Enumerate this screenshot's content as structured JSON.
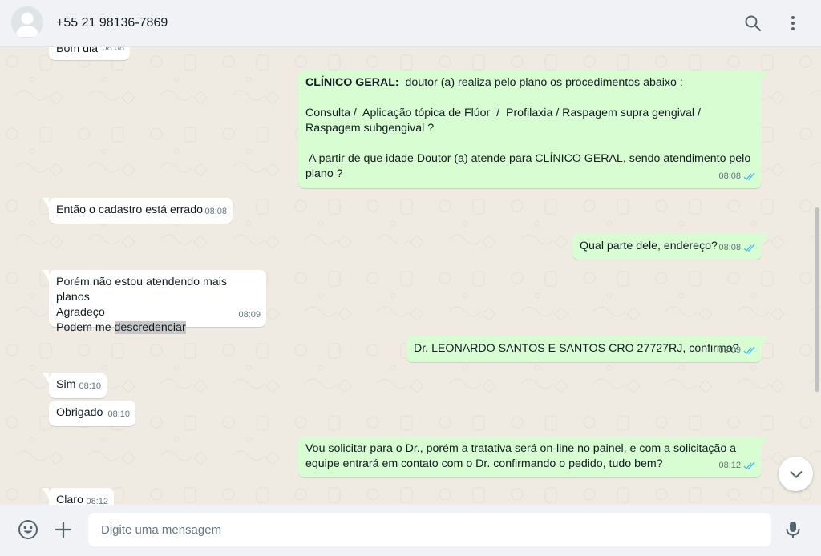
{
  "header": {
    "contact_name": "+55 21 98136-7869",
    "icons": [
      "avatar-placeholder",
      "search-icon",
      "menu-kebab-icon"
    ]
  },
  "messages": [
    {
      "dir": "in",
      "text": "Bom dia",
      "time": "08:08"
    },
    {
      "dir": "out",
      "bold_prefix": "CLÍNICO GERAL:",
      "lines": [
        "  doutor (a) realiza pelo plano os procedimentos abaixo :",
        "",
        "Consulta /  Aplicação tópica de Flúor  /  Profilaxia / Raspagem supra gengival / Raspagem subgengival ?",
        "",
        " A partir de que idade Doutor (a) atende para CLÍNICO GERAL, sendo atendimento pelo plano ?"
      ],
      "time": "08:08",
      "status": "read"
    },
    {
      "dir": "in",
      "text": "Então o cadastro está errado",
      "time": "08:08"
    },
    {
      "dir": "out",
      "text": "Qual parte dele, endereço?",
      "time": "08:08",
      "status": "read"
    },
    {
      "dir": "in",
      "lines": [
        "Porém não estou atendendo mais planos",
        "Agradeço",
        "Podem me "
      ],
      "highlight": "descredenciar",
      "time": "08:09"
    },
    {
      "dir": "out",
      "text": "Dr. LEONARDO SANTOS E SANTOS CRO 27727RJ, confirma?",
      "time": "08:09",
      "status": "read"
    },
    {
      "dir": "in",
      "text": "Sim",
      "time": "08:10"
    },
    {
      "dir": "in",
      "text": "Obrigado",
      "time": "08:10"
    },
    {
      "dir": "out",
      "lines": [
        "Vou solicitar para o Dr., porém a tratativa será on-line no painel, e com a solicitação a",
        "equipe entrará em contato com o Dr. confirmando o pedido, tudo bem?"
      ],
      "time": "08:12",
      "status": "read"
    },
    {
      "dir": "in",
      "text": "Claro",
      "time": "08:12"
    }
  ],
  "footer": {
    "placeholder": "Digite uma mensagem",
    "icons": [
      "emoji-icon",
      "attach-plus-icon",
      "microphone-icon"
    ]
  },
  "colors": {
    "chat_bg": "#efeae2",
    "incoming_bubble": "#ffffff",
    "outgoing_bubble": "#d9fdd3",
    "read_ticks": "#53bdeb",
    "header_bg": "#f0f2f5"
  }
}
